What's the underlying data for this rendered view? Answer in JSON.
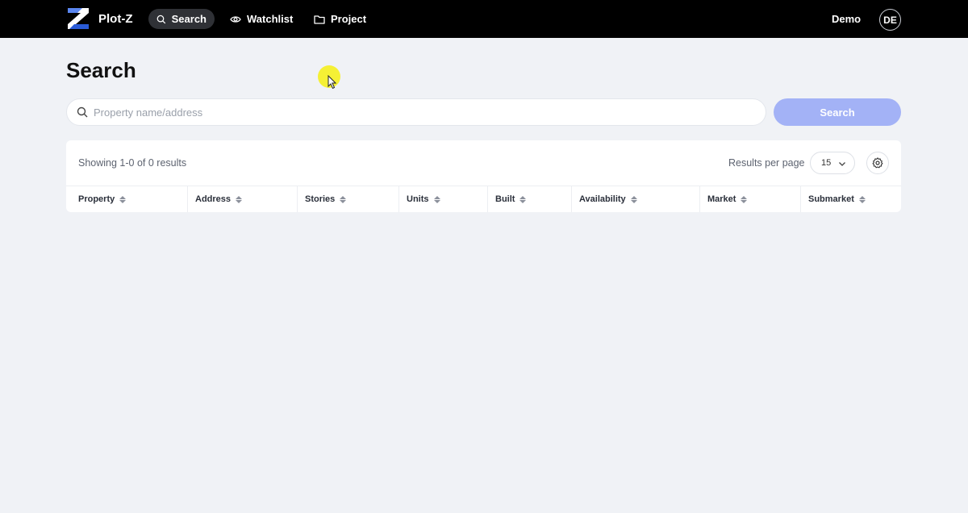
{
  "app": {
    "name": "Plot-Z"
  },
  "nav": [
    {
      "label": "Search",
      "icon": "search-icon",
      "active": true
    },
    {
      "label": "Watchlist",
      "icon": "eye-icon",
      "active": false
    },
    {
      "label": "Project",
      "icon": "folder-icon",
      "active": false
    }
  ],
  "user": {
    "name": "Demo",
    "initials": "DE"
  },
  "page": {
    "title": "Search"
  },
  "search": {
    "placeholder": "Property name/address",
    "value": "",
    "button_label": "Search"
  },
  "results": {
    "summary": "Showing 1-0 of 0 results",
    "per_page_label": "Results per page",
    "per_page_value": "15"
  },
  "table": {
    "columns": [
      "Property",
      "Address",
      "Stories",
      "Units",
      "Built",
      "Availability",
      "Market",
      "Submarket"
    ]
  },
  "colors": {
    "accent": "#a3b2f6",
    "brand_blue": "#2a5bd7",
    "topbar": "#000000"
  }
}
